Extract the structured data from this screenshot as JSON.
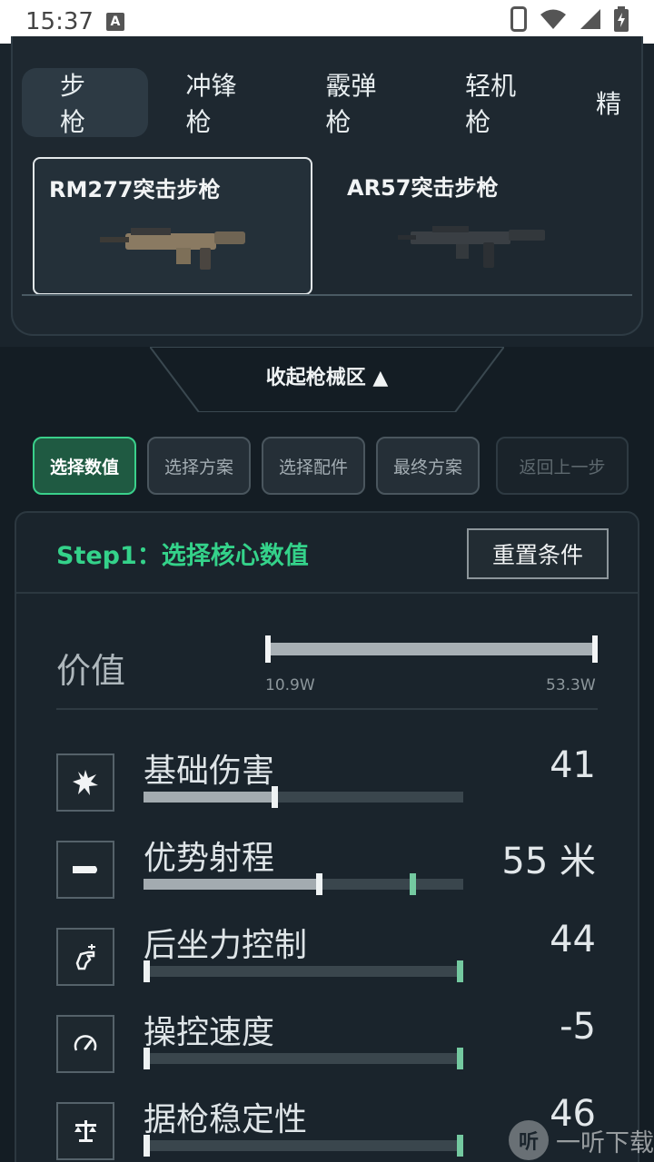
{
  "status_bar": {
    "time": "15:37",
    "a_badge": "A",
    "icons": [
      "phone-icon",
      "wifi-icon",
      "signal-icon",
      "battery-charging-icon"
    ]
  },
  "weapon_tabs": [
    {
      "label": "步枪",
      "active": true
    },
    {
      "label": "冲锋枪",
      "active": false
    },
    {
      "label": "霰弹枪",
      "active": false
    },
    {
      "label": "轻机枪",
      "active": false
    },
    {
      "label": "精",
      "active": false
    }
  ],
  "guns": [
    {
      "name": "RM277突击步枪",
      "selected": true,
      "color": "#8a7a62"
    },
    {
      "name": "AR57突击步枪",
      "selected": false,
      "color": "#3a3f44"
    }
  ],
  "collapse_label": "收起枪械区 ▲",
  "steps": [
    {
      "label": "选择数值",
      "state": "active"
    },
    {
      "label": "选择方案",
      "state": "normal"
    },
    {
      "label": "选择配件",
      "state": "normal"
    },
    {
      "label": "最终方案",
      "state": "normal"
    },
    {
      "label": "返回上一步",
      "state": "disabled"
    }
  ],
  "step_title": "Step1：选择核心数值",
  "reset_label": "重置条件",
  "price": {
    "label": "价值",
    "min": "10.9W",
    "max": "53.3W"
  },
  "stats": [
    {
      "name": "基础伤害",
      "value": "41",
      "icon": "explosion-icon",
      "fill": 0.41,
      "marker": null
    },
    {
      "name": "优势射程",
      "value": "55 米",
      "icon": "bullet-icon",
      "fill": 0.55,
      "marker": 0.85
    },
    {
      "name": "后坐力控制",
      "value": "44",
      "icon": "recoil-hand-icon",
      "fill": 0.0,
      "marker": 1.0
    },
    {
      "name": "操控速度",
      "value": "-5",
      "icon": "speedometer-icon",
      "fill": 0.0,
      "marker": 1.0
    },
    {
      "name": "据枪稳定性",
      "value": "46",
      "icon": "balance-scale-icon",
      "fill": 0.0,
      "marker": 1.0
    }
  ],
  "watermark": {
    "logo_text": "听",
    "text": "一听下载"
  },
  "colors": {
    "accent_green": "#34d28a",
    "background": "#141d24",
    "panel": "#1a242c"
  }
}
